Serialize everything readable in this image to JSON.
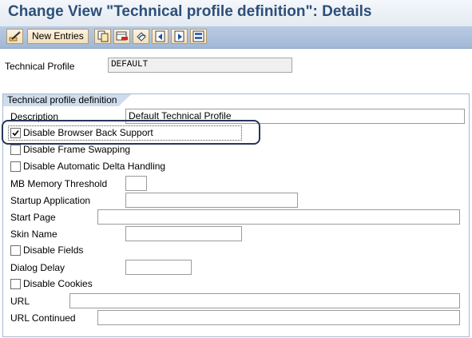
{
  "title": "Change View \"Technical profile definition\": Details",
  "toolbar": {
    "new_entries_label": "New Entries",
    "icons": [
      "display-change-icon",
      "copy-icon",
      "delete-icon",
      "undo-icon",
      "previous-entry-icon",
      "next-entry-icon",
      "select-all-icon"
    ]
  },
  "header_field": {
    "label": "Technical Profile",
    "value": "DEFAULT"
  },
  "group": {
    "title": "Technical profile definition",
    "description": {
      "label": "Description",
      "value": "Default Technical Profile"
    },
    "disable_browser_back": {
      "label": "Disable Browser Back Support",
      "checked": true
    },
    "disable_frame_swapping": {
      "label": "Disable Frame Swapping",
      "checked": false
    },
    "disable_auto_delta": {
      "label": "Disable Automatic Delta Handling",
      "checked": false
    },
    "mb_memory_threshold": {
      "label": "MB Memory Threshold",
      "value": ""
    },
    "startup_application": {
      "label": "Startup Application",
      "value": ""
    },
    "start_page": {
      "label": "Start Page",
      "value": ""
    },
    "skin_name": {
      "label": "Skin Name",
      "value": ""
    },
    "disable_fields": {
      "label": "Disable Fields",
      "checked": false
    },
    "dialog_delay": {
      "label": "Dialog Delay",
      "value": ""
    },
    "disable_cookies": {
      "label": "Disable Cookies",
      "checked": false
    },
    "url": {
      "label": "URL",
      "value": ""
    },
    "url_continued": {
      "label": "URL Continued",
      "value": ""
    }
  },
  "colors": {
    "title_text": "#2d4f79",
    "toolbar_bg": "#a2b8d6",
    "group_header_bg": "#cfdcec",
    "highlight_border": "#27365a"
  }
}
